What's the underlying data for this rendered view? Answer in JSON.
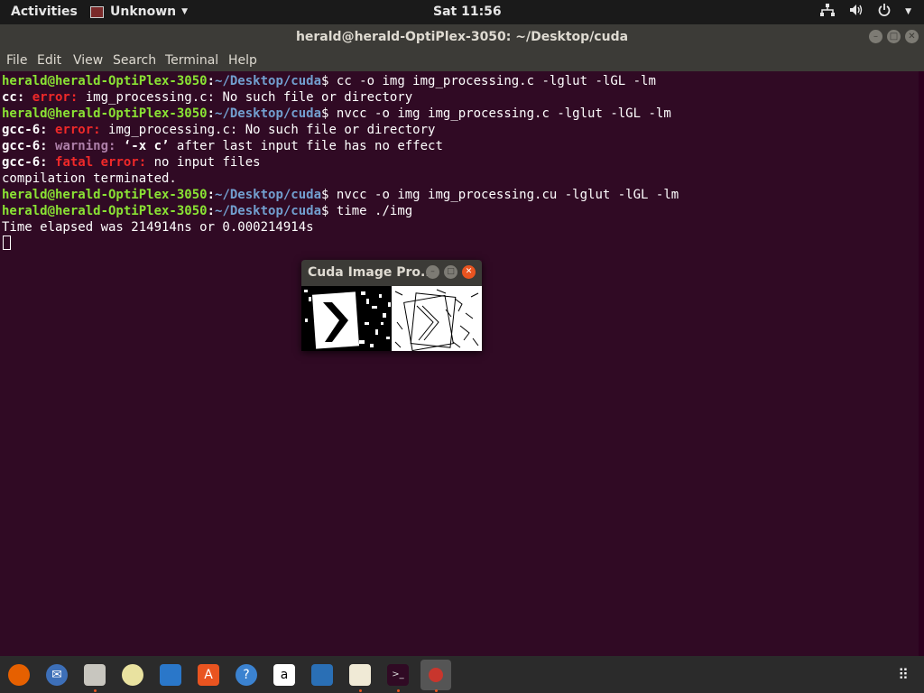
{
  "topbar": {
    "activities": "Activities",
    "app_menu": "Unknown",
    "clock": "Sat 11:56"
  },
  "window": {
    "title": "herald@herald-OptiPlex-3050: ~/Desktop/cuda"
  },
  "menu": {
    "file": "File",
    "edit": "Edit",
    "view": "View",
    "search": "Search",
    "terminal": "Terminal",
    "help": "Help"
  },
  "terminal": {
    "prompt_user": "herald@herald-OptiPlex-3050",
    "prompt_sep": ":",
    "prompt_path": "~/Desktop/cuda",
    "prompt_end": "$ ",
    "line1_cmd": "cc -o img img_processing.c -lglut -lGL -lm",
    "line2_prefix": "cc: ",
    "line2_tag": "error: ",
    "line2_msg": "img_processing.c: No such file or directory",
    "line3_cmd": "nvcc -o img img_processing.c -lglut -lGL -lm",
    "line4_prefix": "gcc-6: ",
    "line4_tag": "error: ",
    "line4_msg": "img_processing.c: No such file or directory",
    "line5_prefix": "gcc-6: ",
    "line5_tag": "warning: ",
    "line5_q": "‘-x c’",
    "line5_msg": " after last input file has no effect",
    "line6_prefix": "gcc-6: ",
    "line6_tag": "fatal error: ",
    "line6_msg": "no input files",
    "line7": "compilation terminated.",
    "line8_cmd": "nvcc -o img img_processing.cu -lglut -lGL -lm",
    "line9_cmd": "time ./img",
    "line10": "Time elapsed was 214914ns or 0.000214914s"
  },
  "cuda_window": {
    "title": "Cuda Image Pro..."
  },
  "colors": {
    "terminal_bg": "#300a24",
    "prompt_user": "#8ae234",
    "prompt_path": "#729fcf",
    "error": "#ef2929",
    "warning": "#ad7fa8",
    "accent": "#e95420"
  },
  "dock_icons": [
    "firefox-icon",
    "thunderbird-icon",
    "files-icon",
    "rhythmbox-icon",
    "writer-icon",
    "software-center-icon",
    "help-icon",
    "amazon-icon",
    "system-monitor-icon",
    "text-editor-icon",
    "terminal-icon",
    "image-app-icon",
    "show-applications-icon"
  ]
}
